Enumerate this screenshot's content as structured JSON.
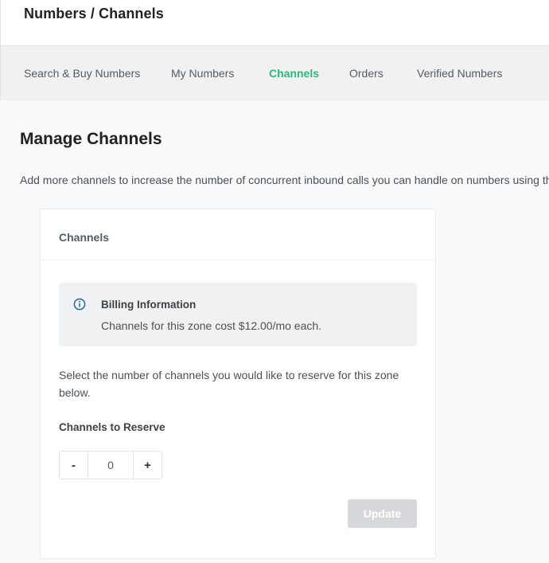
{
  "header": {
    "title": "Numbers / Channels"
  },
  "tabs": [
    {
      "label": "Search & Buy Numbers",
      "active": false
    },
    {
      "label": "My Numbers",
      "active": false
    },
    {
      "label": "Channels",
      "active": true
    },
    {
      "label": "Orders",
      "active": false
    },
    {
      "label": "Verified Numbers",
      "active": false
    }
  ],
  "main": {
    "title": "Manage Channels",
    "description": "Add more channels to increase the number of concurrent inbound calls you can handle on numbers using th"
  },
  "card": {
    "title": "Channels",
    "billing": {
      "icon": "info-icon",
      "title": "Billing Information",
      "text": "Channels for this zone cost $12.00/mo each."
    },
    "select_text": "Select the number of channels you would like to reserve for this zone below.",
    "reserve_label": "Channels to Reserve",
    "stepper": {
      "minus_label": "-",
      "value": "0",
      "plus_label": "+"
    },
    "update_label": "Update"
  },
  "colors": {
    "accent": "#2eb77a",
    "info_icon": "#2f6fb0",
    "disabled_button": "#d6d8db"
  }
}
